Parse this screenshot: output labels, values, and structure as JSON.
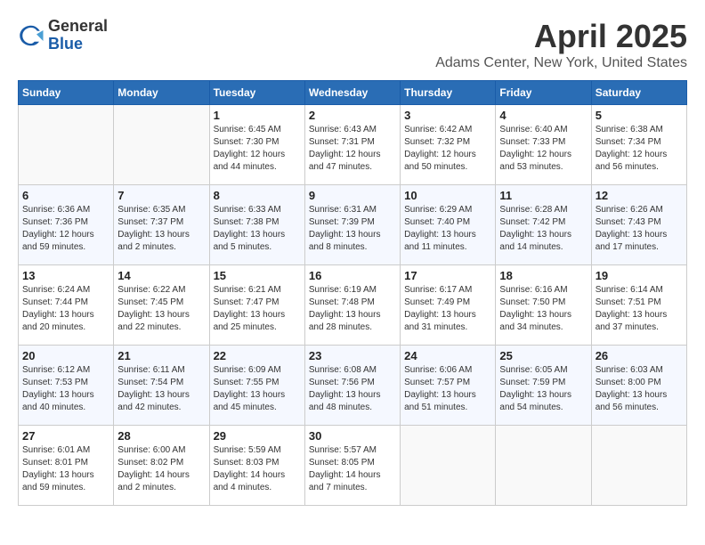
{
  "header": {
    "logo_general": "General",
    "logo_blue": "Blue",
    "month": "April 2025",
    "location": "Adams Center, New York, United States"
  },
  "weekdays": [
    "Sunday",
    "Monday",
    "Tuesday",
    "Wednesday",
    "Thursday",
    "Friday",
    "Saturday"
  ],
  "weeks": [
    [
      {
        "day": "",
        "info": ""
      },
      {
        "day": "",
        "info": ""
      },
      {
        "day": "1",
        "info": "Sunrise: 6:45 AM\nSunset: 7:30 PM\nDaylight: 12 hours\nand 44 minutes."
      },
      {
        "day": "2",
        "info": "Sunrise: 6:43 AM\nSunset: 7:31 PM\nDaylight: 12 hours\nand 47 minutes."
      },
      {
        "day": "3",
        "info": "Sunrise: 6:42 AM\nSunset: 7:32 PM\nDaylight: 12 hours\nand 50 minutes."
      },
      {
        "day": "4",
        "info": "Sunrise: 6:40 AM\nSunset: 7:33 PM\nDaylight: 12 hours\nand 53 minutes."
      },
      {
        "day": "5",
        "info": "Sunrise: 6:38 AM\nSunset: 7:34 PM\nDaylight: 12 hours\nand 56 minutes."
      }
    ],
    [
      {
        "day": "6",
        "info": "Sunrise: 6:36 AM\nSunset: 7:36 PM\nDaylight: 12 hours\nand 59 minutes."
      },
      {
        "day": "7",
        "info": "Sunrise: 6:35 AM\nSunset: 7:37 PM\nDaylight: 13 hours\nand 2 minutes."
      },
      {
        "day": "8",
        "info": "Sunrise: 6:33 AM\nSunset: 7:38 PM\nDaylight: 13 hours\nand 5 minutes."
      },
      {
        "day": "9",
        "info": "Sunrise: 6:31 AM\nSunset: 7:39 PM\nDaylight: 13 hours\nand 8 minutes."
      },
      {
        "day": "10",
        "info": "Sunrise: 6:29 AM\nSunset: 7:40 PM\nDaylight: 13 hours\nand 11 minutes."
      },
      {
        "day": "11",
        "info": "Sunrise: 6:28 AM\nSunset: 7:42 PM\nDaylight: 13 hours\nand 14 minutes."
      },
      {
        "day": "12",
        "info": "Sunrise: 6:26 AM\nSunset: 7:43 PM\nDaylight: 13 hours\nand 17 minutes."
      }
    ],
    [
      {
        "day": "13",
        "info": "Sunrise: 6:24 AM\nSunset: 7:44 PM\nDaylight: 13 hours\nand 20 minutes."
      },
      {
        "day": "14",
        "info": "Sunrise: 6:22 AM\nSunset: 7:45 PM\nDaylight: 13 hours\nand 22 minutes."
      },
      {
        "day": "15",
        "info": "Sunrise: 6:21 AM\nSunset: 7:47 PM\nDaylight: 13 hours\nand 25 minutes."
      },
      {
        "day": "16",
        "info": "Sunrise: 6:19 AM\nSunset: 7:48 PM\nDaylight: 13 hours\nand 28 minutes."
      },
      {
        "day": "17",
        "info": "Sunrise: 6:17 AM\nSunset: 7:49 PM\nDaylight: 13 hours\nand 31 minutes."
      },
      {
        "day": "18",
        "info": "Sunrise: 6:16 AM\nSunset: 7:50 PM\nDaylight: 13 hours\nand 34 minutes."
      },
      {
        "day": "19",
        "info": "Sunrise: 6:14 AM\nSunset: 7:51 PM\nDaylight: 13 hours\nand 37 minutes."
      }
    ],
    [
      {
        "day": "20",
        "info": "Sunrise: 6:12 AM\nSunset: 7:53 PM\nDaylight: 13 hours\nand 40 minutes."
      },
      {
        "day": "21",
        "info": "Sunrise: 6:11 AM\nSunset: 7:54 PM\nDaylight: 13 hours\nand 42 minutes."
      },
      {
        "day": "22",
        "info": "Sunrise: 6:09 AM\nSunset: 7:55 PM\nDaylight: 13 hours\nand 45 minutes."
      },
      {
        "day": "23",
        "info": "Sunrise: 6:08 AM\nSunset: 7:56 PM\nDaylight: 13 hours\nand 48 minutes."
      },
      {
        "day": "24",
        "info": "Sunrise: 6:06 AM\nSunset: 7:57 PM\nDaylight: 13 hours\nand 51 minutes."
      },
      {
        "day": "25",
        "info": "Sunrise: 6:05 AM\nSunset: 7:59 PM\nDaylight: 13 hours\nand 54 minutes."
      },
      {
        "day": "26",
        "info": "Sunrise: 6:03 AM\nSunset: 8:00 PM\nDaylight: 13 hours\nand 56 minutes."
      }
    ],
    [
      {
        "day": "27",
        "info": "Sunrise: 6:01 AM\nSunset: 8:01 PM\nDaylight: 13 hours\nand 59 minutes."
      },
      {
        "day": "28",
        "info": "Sunrise: 6:00 AM\nSunset: 8:02 PM\nDaylight: 14 hours\nand 2 minutes."
      },
      {
        "day": "29",
        "info": "Sunrise: 5:59 AM\nSunset: 8:03 PM\nDaylight: 14 hours\nand 4 minutes."
      },
      {
        "day": "30",
        "info": "Sunrise: 5:57 AM\nSunset: 8:05 PM\nDaylight: 14 hours\nand 7 minutes."
      },
      {
        "day": "",
        "info": ""
      },
      {
        "day": "",
        "info": ""
      },
      {
        "day": "",
        "info": ""
      }
    ]
  ]
}
